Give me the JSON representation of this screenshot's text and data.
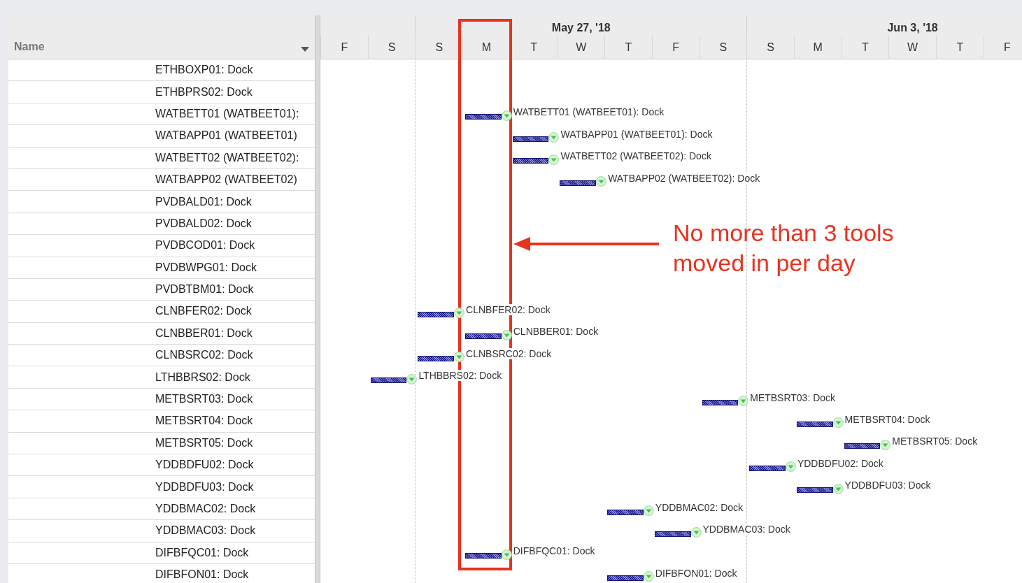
{
  "name_column": {
    "header": "Name"
  },
  "timeline": {
    "weeks": [
      {
        "label": "May 27, '18"
      },
      {
        "label": "Jun 3, '18"
      }
    ],
    "days": [
      "F",
      "S",
      "S",
      "M",
      "T",
      "W",
      "T",
      "F",
      "S",
      "S",
      "M",
      "T",
      "W",
      "T",
      "F"
    ]
  },
  "rows": [
    {
      "name": "ETHBOXP01: Dock"
    },
    {
      "name": "ETHBPRS02: Dock"
    },
    {
      "name": "WATBETT01 (WATBEET01):",
      "bar_label": "WATBETT01 (WATBEET01): Dock"
    },
    {
      "name": "WATBAPP01 (WATBEET01)",
      "bar_label": "WATBAPP01 (WATBEET01): Dock"
    },
    {
      "name": "WATBETT02 (WATBEET02):",
      "bar_label": "WATBETT02 (WATBEET02): Dock"
    },
    {
      "name": "WATBAPP02 (WATBEET02)",
      "bar_label": "WATBAPP02 (WATBEET02): Dock"
    },
    {
      "name": "PVDBALD01: Dock"
    },
    {
      "name": "PVDBALD02: Dock"
    },
    {
      "name": "PVDBCOD01: Dock"
    },
    {
      "name": "PVDBWPG01: Dock"
    },
    {
      "name": "PVDBTBM01: Dock"
    },
    {
      "name": "CLNBFER02: Dock",
      "bar_label": "CLNBFER02: Dock"
    },
    {
      "name": "CLNBBER01: Dock",
      "bar_label": "CLNBBER01: Dock"
    },
    {
      "name": "CLNBSRC02: Dock",
      "bar_label": "CLNBSRC02: Dock"
    },
    {
      "name": "LTHBBRS02: Dock",
      "bar_label": "LTHBBRS02: Dock"
    },
    {
      "name": "METBSRT03: Dock",
      "bar_label": "METBSRT03: Dock"
    },
    {
      "name": "METBSRT04: Dock",
      "bar_label": "METBSRT04: Dock"
    },
    {
      "name": "METBSRT05: Dock",
      "bar_label": "METBSRT05: Dock"
    },
    {
      "name": "YDDBDFU02: Dock",
      "bar_label": "YDDBDFU02: Dock"
    },
    {
      "name": "YDDBDFU03: Dock",
      "bar_label": "YDDBDFU03: Dock"
    },
    {
      "name": "YDDBMAC02: Dock",
      "bar_label": "YDDBMAC02: Dock"
    },
    {
      "name": "YDDBMAC03: Dock",
      "bar_label": "YDDBMAC03: Dock"
    },
    {
      "name": "DIFBFQC01: Dock",
      "bar_label": "DIFBFQC01: Dock"
    },
    {
      "name": "DIFBFON01: Dock",
      "bar_label": "DIFBFON01: Dock"
    }
  ],
  "annotation": {
    "text": "No more than 3 tools moved in per day"
  }
}
